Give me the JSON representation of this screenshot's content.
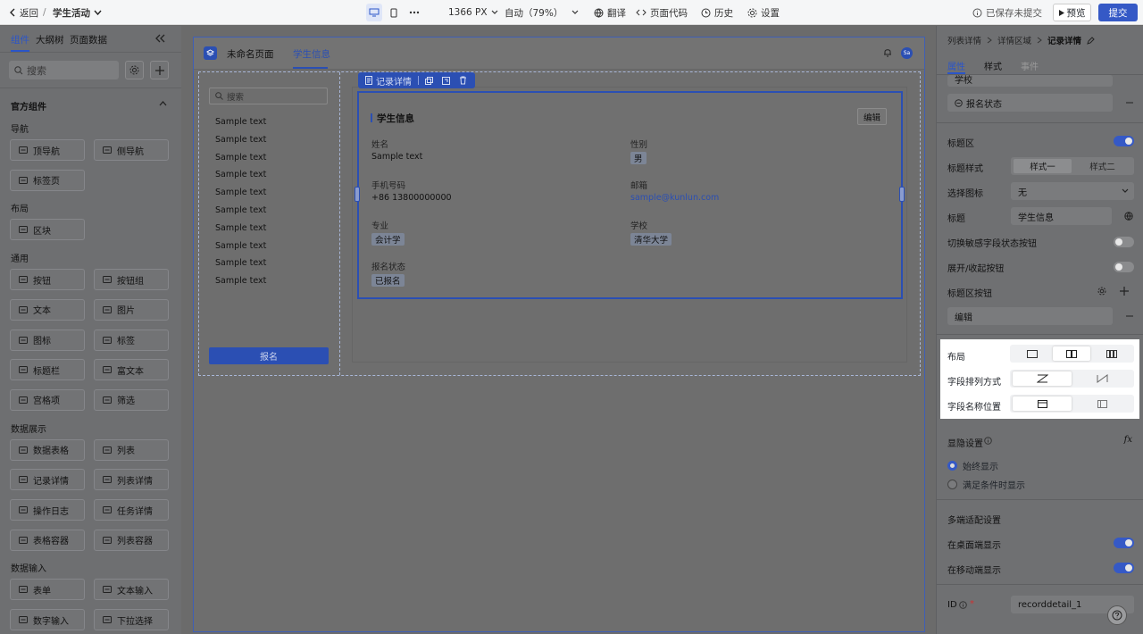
{
  "topbar": {
    "back_label": "返回",
    "separator": "/",
    "app_name": "学生活动",
    "width_value": "1366 PX",
    "zoom_value": "自动（79%）",
    "translate_label": "翻译",
    "page_code_label": "页面代码",
    "history_label": "历史",
    "settings_label": "设置",
    "save_status": "已保存未提交",
    "preview_label": "预览",
    "submit_label": "提交"
  },
  "left_panel": {
    "tabs": [
      "组件",
      "大纲树",
      "页面数据"
    ],
    "search_placeholder": "搜索",
    "section_title": "官方组件",
    "groups": [
      {
        "title": "导航",
        "items": [
          {
            "label": "顶导航",
            "icon": "top-nav-icon"
          },
          {
            "label": "侧导航",
            "icon": "side-nav-icon"
          },
          {
            "label": "标签页",
            "icon": "tabs-icon"
          }
        ]
      },
      {
        "title": "布局",
        "items": [
          {
            "label": "区块",
            "icon": "block-icon"
          }
        ]
      },
      {
        "title": "通用",
        "items": [
          {
            "label": "按钮",
            "icon": "button-icon"
          },
          {
            "label": "按钮组",
            "icon": "button-group-icon"
          },
          {
            "label": "文本",
            "icon": "text-icon"
          },
          {
            "label": "图片",
            "icon": "image-icon"
          },
          {
            "label": "图标",
            "icon": "smile-icon"
          },
          {
            "label": "标签",
            "icon": "tag-icon"
          },
          {
            "label": "标题栏",
            "icon": "heading-icon"
          },
          {
            "label": "富文本",
            "icon": "rich-text-icon"
          },
          {
            "label": "宫格项",
            "icon": "grid-item-icon"
          },
          {
            "label": "筛选",
            "icon": "filter-icon"
          }
        ]
      },
      {
        "title": "数据展示",
        "items": [
          {
            "label": "数据表格",
            "icon": "table-icon"
          },
          {
            "label": "列表",
            "icon": "list-icon"
          },
          {
            "label": "记录详情",
            "icon": "record-icon"
          },
          {
            "label": "列表详情",
            "icon": "list-detail-icon"
          },
          {
            "label": "操作日志",
            "icon": "log-icon"
          },
          {
            "label": "任务详情",
            "icon": "task-icon"
          },
          {
            "label": "表格容器",
            "icon": "table-container-icon"
          },
          {
            "label": "列表容器",
            "icon": "list-container-icon"
          }
        ]
      },
      {
        "title": "数据输入",
        "items": [
          {
            "label": "表单",
            "icon": "form-icon"
          },
          {
            "label": "文本输入",
            "icon": "text-input-icon"
          },
          {
            "label": "数字输入",
            "icon": "number-input-icon"
          },
          {
            "label": "下拉选择",
            "icon": "select-icon"
          }
        ]
      }
    ]
  },
  "canvas": {
    "page_name": "未命名页面",
    "tab_label": "学生信息",
    "avatar_text": "Sa",
    "sidebar_search_placeholder": "搜索",
    "sidebar_items": [
      "Sample text",
      "Sample text",
      "Sample text",
      "Sample text",
      "Sample text",
      "Sample text",
      "Sample text",
      "Sample text",
      "Sample text",
      "Sample text"
    ],
    "signup_button": "报名",
    "toolbar_label": "记录详情",
    "detail": {
      "title": "学生信息",
      "edit_button": "编辑",
      "fields": [
        {
          "label": "姓名",
          "value": "Sample text",
          "kind": "text"
        },
        {
          "label": "性别",
          "value": "男",
          "kind": "tag"
        },
        {
          "label": "手机号码",
          "value": "+86 13800000000",
          "kind": "text"
        },
        {
          "label": "邮箱",
          "value": "sample@kunlun.com",
          "kind": "link"
        },
        {
          "label": "专业",
          "value": "会计学",
          "kind": "tag"
        },
        {
          "label": "学校",
          "value": "清华大学",
          "kind": "tag"
        },
        {
          "label": "报名状态",
          "value": "已报名",
          "kind": "tag"
        }
      ]
    }
  },
  "right_panel": {
    "breadcrumb": [
      "列表详情",
      "详情区域",
      "记录详情"
    ],
    "tabs": [
      "属性",
      "样式",
      "事件"
    ],
    "field_partial": "学校",
    "field_item": "报名状态",
    "title_area_label": "标题区",
    "title_style_label": "标题样式",
    "title_style_options": [
      "样式一",
      "样式二"
    ],
    "icon_label": "选择图标",
    "icon_value": "无",
    "title_label": "标题",
    "title_value": "学生信息",
    "sensitive_toggle_label": "切换敏感字段状态按钮",
    "expand_toggle_label": "展开/收起按钮",
    "title_buttons_label": "标题区按钮",
    "title_button_item": "编辑",
    "layout_label": "布局",
    "field_order_label": "字段排列方式",
    "field_name_pos_label": "字段名称位置",
    "visibility_label": "显隐设置",
    "visibility_options": [
      "始终显示",
      "满足条件时显示"
    ],
    "multi_label": "多端适配设置",
    "desktop_label": "在桌面端显示",
    "mobile_label": "在移动端显示",
    "id_label": "ID",
    "id_value": "recorddetail_1",
    "help_icon": "help-icon",
    "fx_label": "fx"
  },
  "colors": {
    "accent": "#2b55c8",
    "highlight": "#ffffff"
  }
}
